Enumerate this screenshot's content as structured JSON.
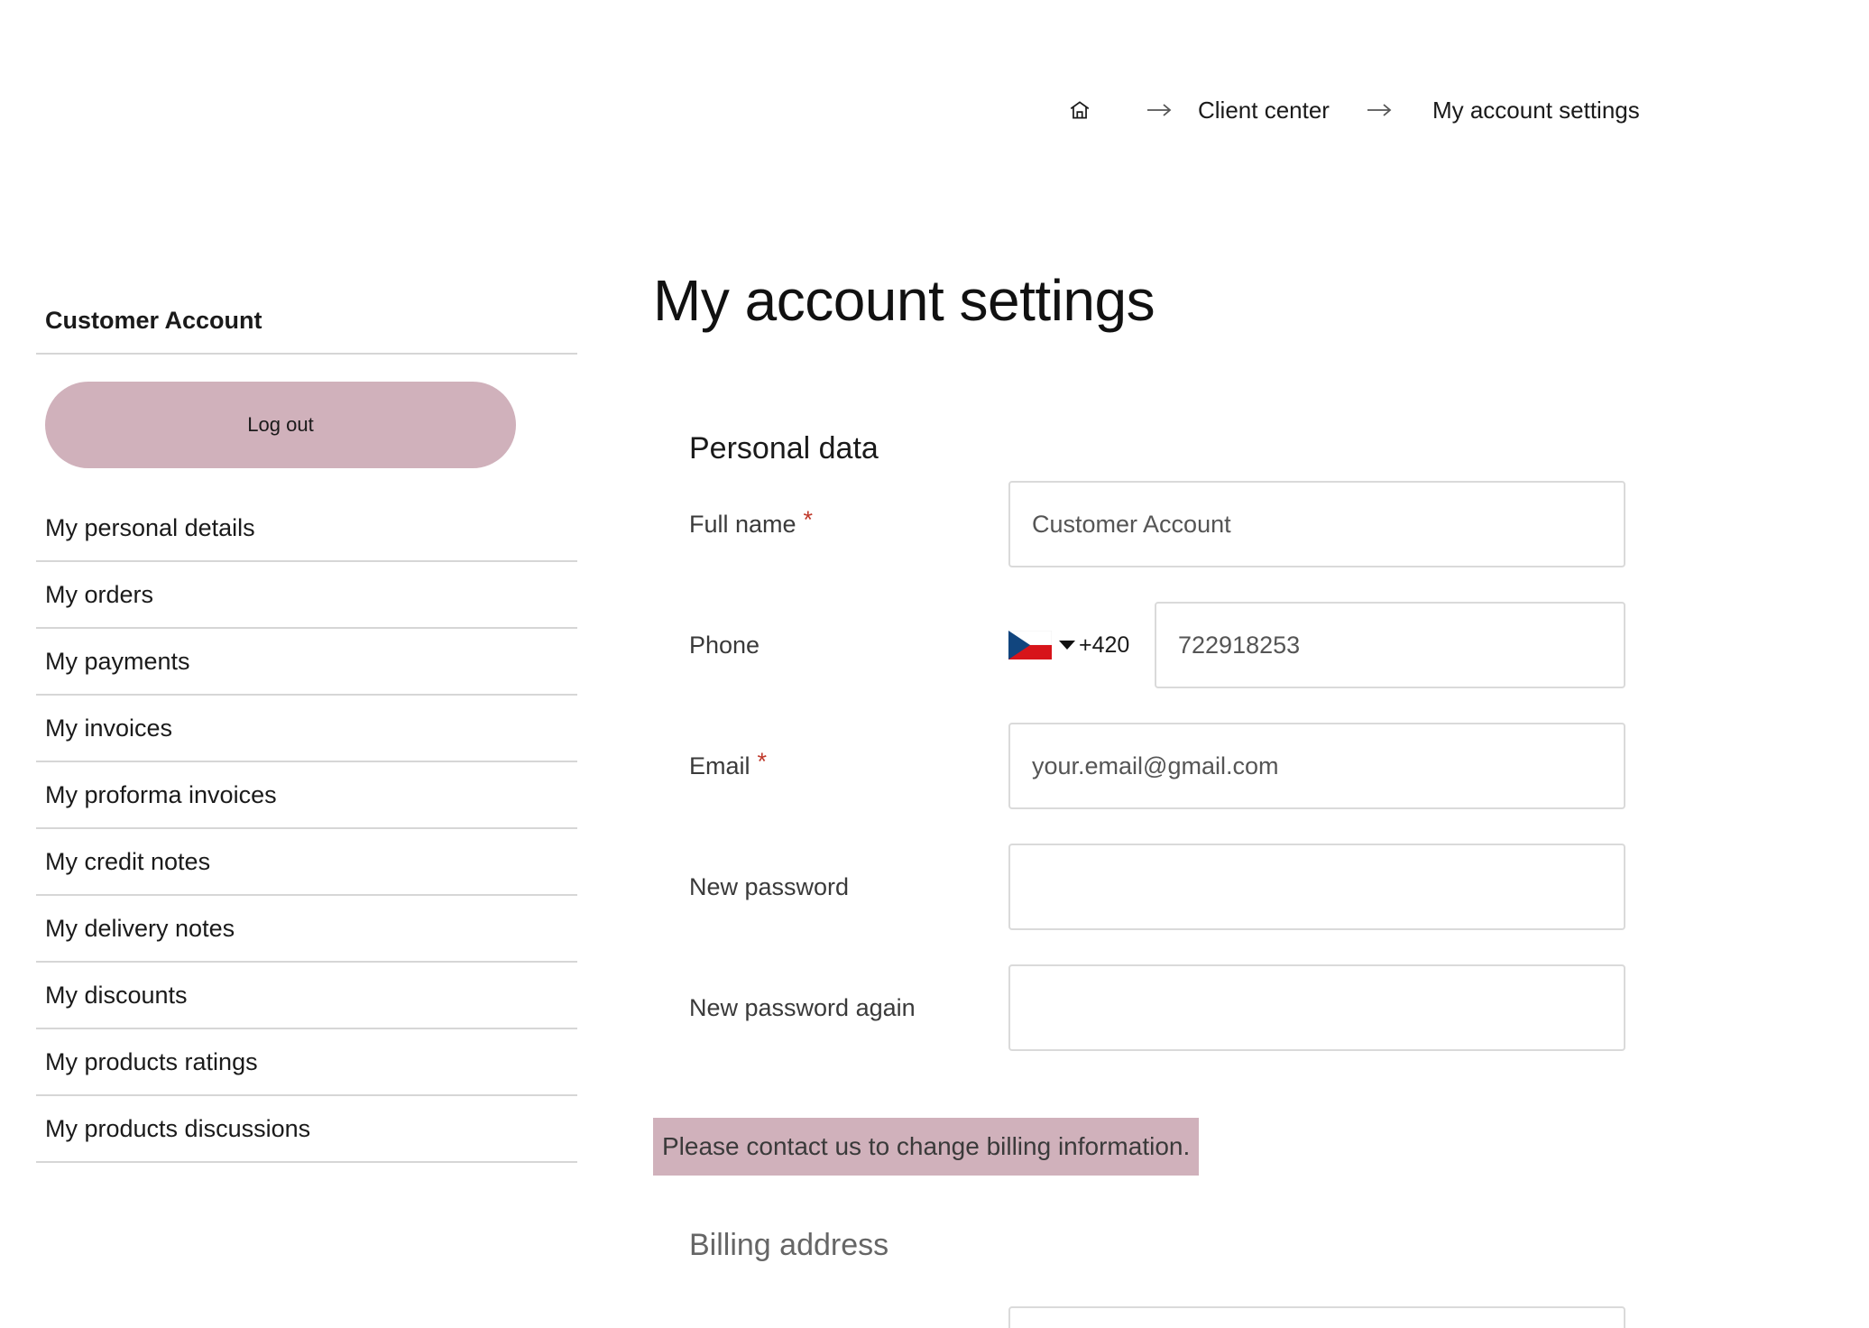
{
  "breadcrumb": {
    "home_icon": "home-icon",
    "separator_icon": "arrow-right-icon",
    "items": [
      {
        "label": "Client center"
      },
      {
        "label": "My account settings"
      }
    ]
  },
  "sidebar": {
    "title": "Customer Account",
    "logout_label": "Log out",
    "items": [
      {
        "label": "My personal details"
      },
      {
        "label": "My orders"
      },
      {
        "label": "My payments"
      },
      {
        "label": "My invoices"
      },
      {
        "label": "My proforma invoices"
      },
      {
        "label": "My credit notes"
      },
      {
        "label": "My delivery notes"
      },
      {
        "label": "My discounts"
      },
      {
        "label": "My products ratings"
      },
      {
        "label": "My products discussions"
      }
    ]
  },
  "main": {
    "title": "My account settings",
    "personal_section_title": "Personal data",
    "fields": {
      "full_name": {
        "label": "Full name",
        "required_mark": "*",
        "value": "Customer Account"
      },
      "phone": {
        "label": "Phone",
        "flag": "czech-flag-icon",
        "dial_code": "+420",
        "value": "722918253"
      },
      "email": {
        "label": "Email",
        "required_mark": "*",
        "placeholder": "your.email@gmail.com"
      },
      "new_password": {
        "label": "New password",
        "value": ""
      },
      "new_password_again": {
        "label": "New password again",
        "value": ""
      }
    },
    "notice": "Please contact us to change billing information.",
    "billing_section_title": "Billing address"
  },
  "colors": {
    "accent": "#d0b1bb",
    "required": "#c0392b",
    "border": "#dadada"
  }
}
